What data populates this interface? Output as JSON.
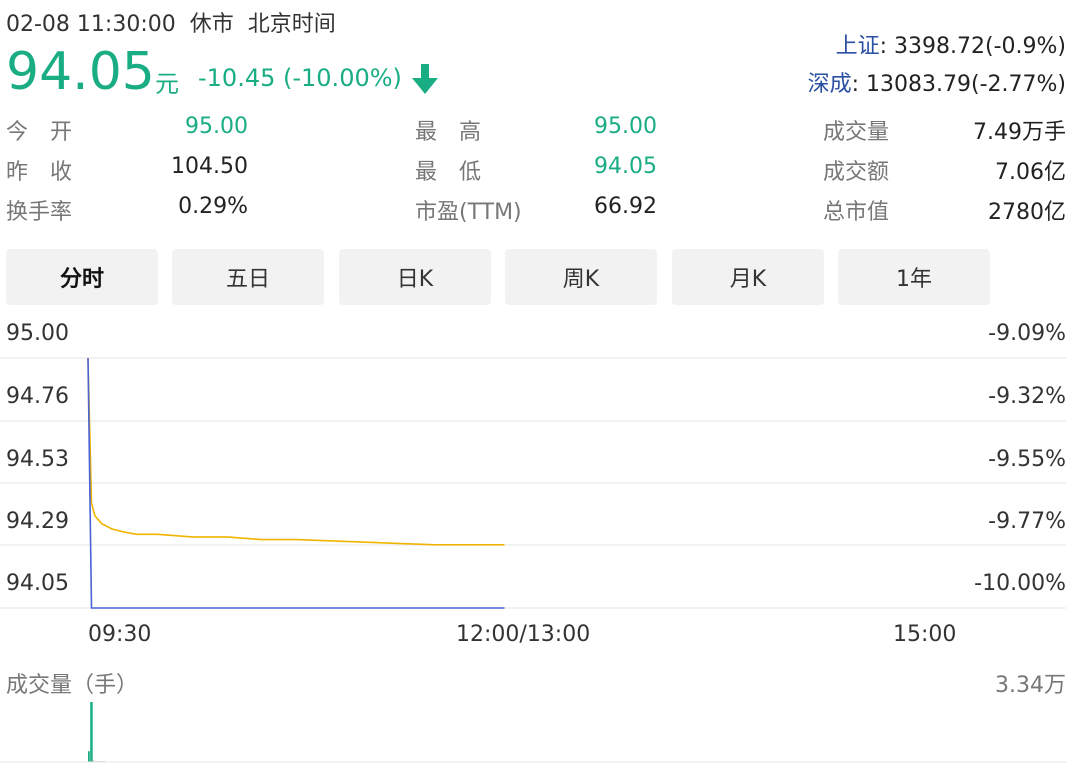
{
  "header": {
    "datetime": "02-08 11:30:00",
    "status": "休市",
    "timezone": "北京时间"
  },
  "quote": {
    "price": "94.05",
    "unit": "元",
    "change": "-10.45 (-10.00%)",
    "direction_icon": "arrow-down-icon",
    "down_color": "#1aad84"
  },
  "indices": [
    {
      "name": "上证",
      "value": ": 3398.72(-0.9%)"
    },
    {
      "name": "深成",
      "value": ": 13083.79(-2.77%)"
    }
  ],
  "stats": [
    {
      "label": "今　开",
      "value": "95.00",
      "color": "green"
    },
    {
      "label": "最　高",
      "value": "95.00",
      "color": "green"
    },
    {
      "label": "成交量",
      "value": "7.49万手",
      "color": "dark"
    },
    {
      "label": "昨　收",
      "value": "104.50",
      "color": "dark"
    },
    {
      "label": "最　低",
      "value": "94.05",
      "color": "green"
    },
    {
      "label": "成交额",
      "value": "7.06亿",
      "color": "dark"
    },
    {
      "label": "换手率",
      "value": "0.29%",
      "color": "dark"
    },
    {
      "label": "市盈(TTM)",
      "value": "66.92",
      "color": "dark"
    },
    {
      "label": "总市值",
      "value": "2780亿",
      "color": "dark"
    }
  ],
  "tabs": [
    {
      "label": "分时",
      "active": true
    },
    {
      "label": "五日",
      "active": false
    },
    {
      "label": "日K",
      "active": false
    },
    {
      "label": "周K",
      "active": false
    },
    {
      "label": "月K",
      "active": false
    },
    {
      "label": "1年",
      "active": false
    }
  ],
  "chart_data": {
    "type": "line",
    "title": "",
    "y_ticks_left": [
      "95.00",
      "94.76",
      "94.53",
      "94.29",
      "94.05"
    ],
    "y_ticks_right": [
      "-9.09%",
      "-9.32%",
      "-9.55%",
      "-9.77%",
      "-10.00%"
    ],
    "x_ticks": [
      "09:30",
      "12:00/13:00",
      "15:00"
    ],
    "ylim": [
      94.05,
      95.0
    ],
    "series": [
      {
        "name": "",
        "color": "#f0b400",
        "x": [
          0,
          1,
          2,
          4,
          7,
          10,
          14,
          20,
          30,
          40,
          50,
          60,
          80,
          100,
          120
        ],
        "y": [
          95.0,
          94.45,
          94.4,
          94.37,
          94.35,
          94.34,
          94.33,
          94.33,
          94.32,
          94.32,
          94.31,
          94.31,
          94.3,
          94.29,
          94.29
        ]
      },
      {
        "name": "",
        "color": "#4a63d9",
        "x": [
          0,
          1,
          30,
          60,
          90,
          120
        ],
        "y": [
          95.0,
          94.05,
          94.05,
          94.05,
          94.05,
          94.05
        ]
      }
    ],
    "session_minutes": 240,
    "volume": {
      "label": "成交量（手）",
      "max_label": "3.34万",
      "max": 33400,
      "color": "#1aad84",
      "values": [
        6000,
        33400,
        1200,
        600,
        500,
        400,
        300,
        300
      ]
    }
  }
}
